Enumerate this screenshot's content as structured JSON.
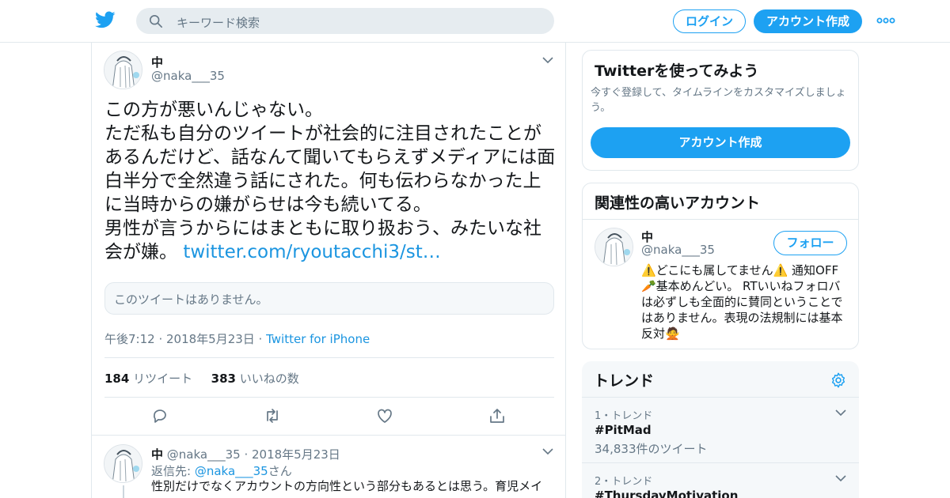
{
  "header": {
    "search_placeholder": "キーワード検索",
    "login_label": "ログイン",
    "signup_label": "アカウント作成"
  },
  "tweet": {
    "display_name": "中",
    "handle": "@naka___35",
    "text": "この方が悪いんじゃない。\nただ私も自分のツイートが社会的に注目されたことがあるんだけど、話なんて聞いてもらえずメディアには面白半分で全然違う話にされた。何も伝わらなかった上に当時からの嫌がらせは今も続いてる。\n男性が言うからにはまともに取り扱おう、みたいな社会が嫌。 ",
    "link": "twitter.com/ryoutacchi3/st…",
    "unavailable_text": "このツイートはありません。",
    "time": "午後7:12 · 2018年5月23日 · ",
    "source": "Twitter for iPhone",
    "retweet_count": "184",
    "retweet_label": " リツイート",
    "like_count": "383",
    "like_label": " いいねの数"
  },
  "reply": {
    "display_name": "中",
    "handle_date": " @naka___35 · 2018年5月23日",
    "reply_to_prefix": "返信先: ",
    "reply_to_handle": "@naka___35",
    "reply_to_suffix": "さん",
    "text": "性別だけでなくアカウントの方向性という部分もあるとは思う。育児メイ"
  },
  "signup_card": {
    "title": "Twitterを使ってみよう",
    "description": "今すぐ登録して、タイムラインをカスタマイズしましょう。",
    "button_label": "アカウント作成"
  },
  "related_card": {
    "title": "関連性の高いアカウント",
    "account": {
      "display_name": "中",
      "handle": "@naka___35",
      "follow_label": "フォロー",
      "bio": "⚠️どこにも属してません⚠️ 通知OFF🥕基本めんどい。 RTいいねフォロバは必ずしも全面的に賛同ということではありません。表現の法規制には基本反対🙅"
    }
  },
  "trends_card": {
    "title": "トレンド",
    "items": [
      {
        "rank": "1・トレンド",
        "name": "#PitMad",
        "count": "34,833件のツイート"
      },
      {
        "rank": "2・トレンド",
        "name": "#ThursdayMotivation",
        "count": ""
      }
    ]
  },
  "colors": {
    "accent": "#1da1f2",
    "link": "#1b95e0",
    "muted": "#657786",
    "border": "#e1e8ed"
  }
}
